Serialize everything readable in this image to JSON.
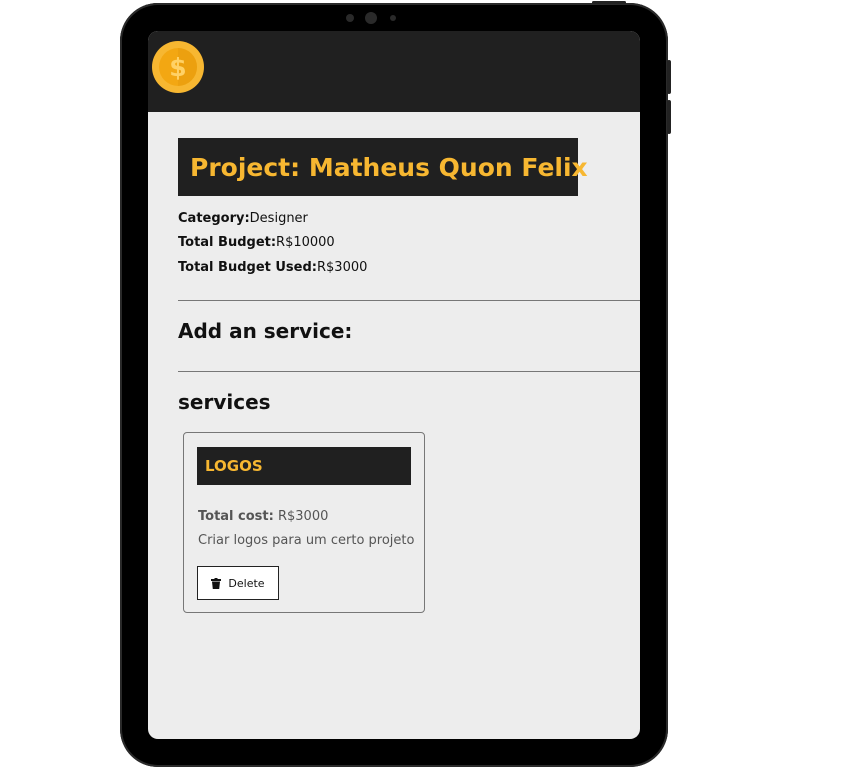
{
  "navbar": {
    "logo_icon": "dollar-coin-icon",
    "coin_symbol": "$",
    "colors": {
      "bar": "#202020",
      "coin_outer": "#f7b731",
      "coin_inner": "#f3a712"
    }
  },
  "project": {
    "title": "Project: Matheus Quon Felix",
    "category_label": "Category:",
    "category_value": "Designer",
    "budget_label": "Total Budget:",
    "budget_value": "R$10000",
    "used_label": "Total Budget Used:",
    "used_value": "R$3000"
  },
  "sections": {
    "add_service": "Add an service:",
    "services": "services"
  },
  "services": [
    {
      "name": "LOGOS",
      "cost_label": "Total cost:",
      "cost_value": "R$3000",
      "description": "Criar logos para um certo projeto",
      "delete_label": "Delete",
      "delete_icon": "trash-icon"
    }
  ],
  "colors": {
    "accent": "#f7b731",
    "dark": "#202020",
    "background": "#ededed"
  }
}
